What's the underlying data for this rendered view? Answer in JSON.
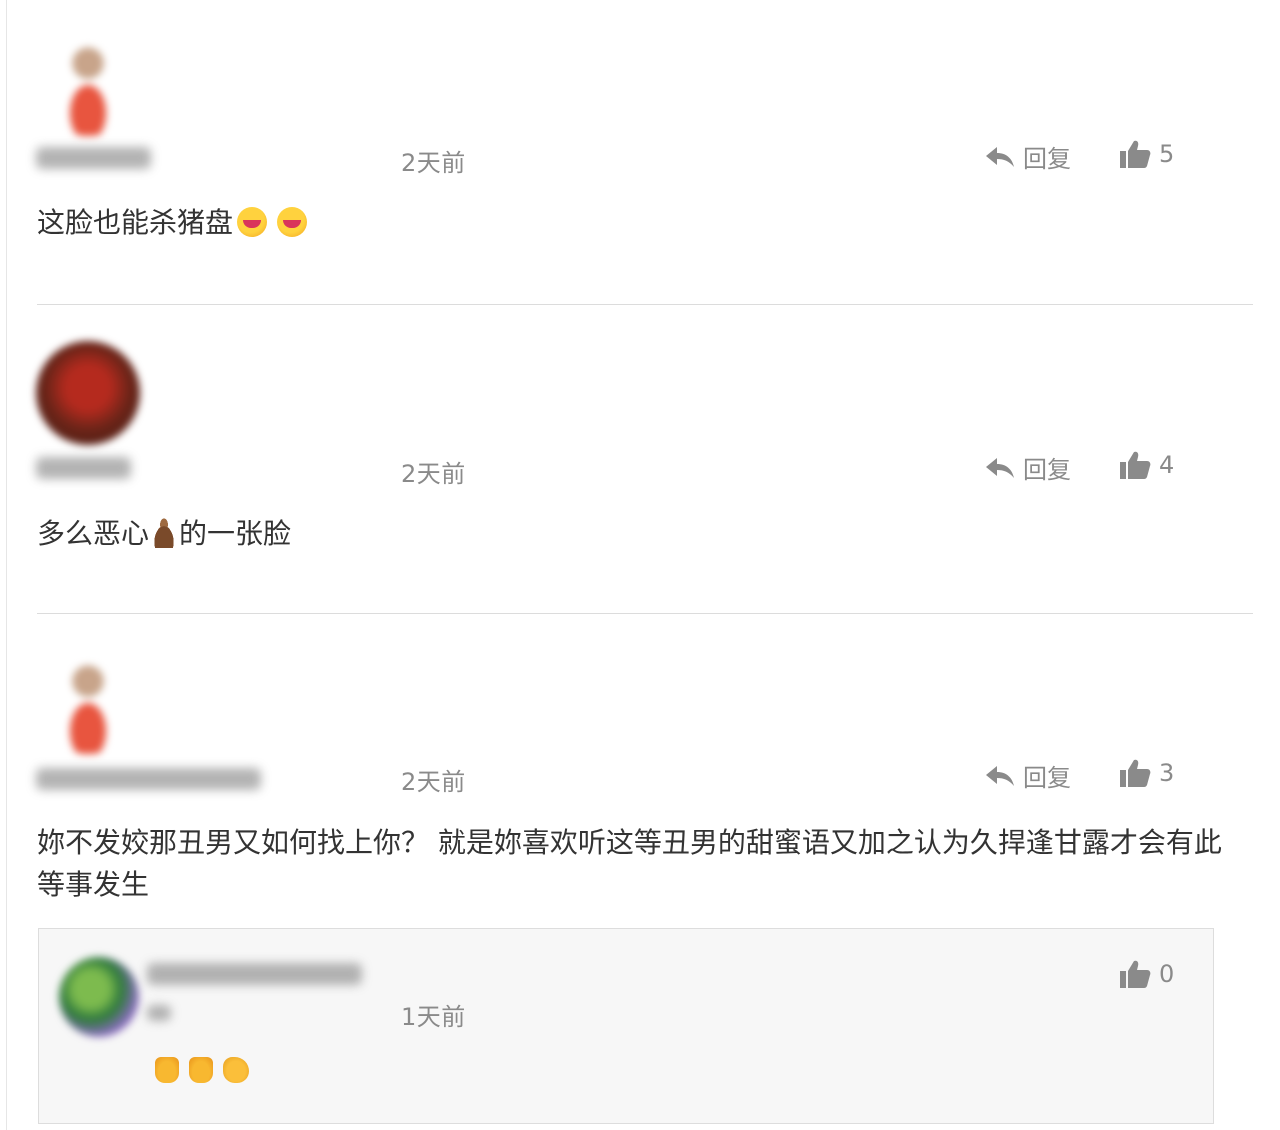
{
  "comments": [
    {
      "time": "2天前",
      "reply_label": "回复",
      "likes": "5",
      "text_main": "这脸也能杀猪盘",
      "emoji_names": [
        "rolling-on-floor-laughing-icon",
        "rolling-on-floor-laughing-icon"
      ]
    },
    {
      "time": "2天前",
      "reply_label": "回复",
      "likes": "4",
      "text_before": "多么恶心",
      "text_after": "的一张脸",
      "emoji_names": [
        "pile-of-poo-icon"
      ]
    },
    {
      "time": "2天前",
      "reply_label": "回复",
      "likes": "3",
      "text_main": "妳不发姣那丑男又如何找上你？ 就是妳喜欢听这等丑男的甜蜜语又加之认为久捍逢甘露才会有此等事发生"
    }
  ],
  "sub_reply": {
    "time": "1天前",
    "likes": "0",
    "emoji_names": [
      "thumbs-up-icon",
      "thumbs-up-icon",
      "clapping-hands-icon"
    ]
  },
  "colors": {
    "text": "#333333",
    "muted": "#8a8a8a",
    "divider": "#dcdcdc",
    "reply_box_bg": "#f7f7f7"
  }
}
